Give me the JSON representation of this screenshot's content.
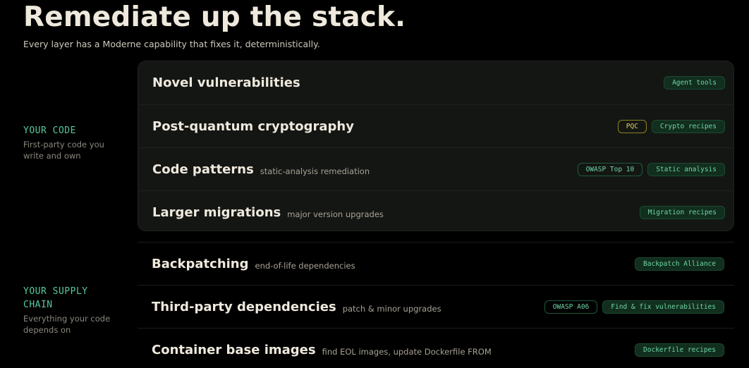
{
  "hero": {
    "title": "Remediate up the stack.",
    "subtitle": "Every layer has a Moderne capability that fixes it, deterministically."
  },
  "sections": [
    {
      "heading": "YOUR CODE",
      "description": "First-party code you write and own",
      "rows": [
        {
          "title": "Novel vulnerabilities",
          "subtitle": "",
          "tags": [
            {
              "label": "Agent tools",
              "style": "green"
            }
          ]
        },
        {
          "title": "Post-quantum cryptography",
          "subtitle": "",
          "tags": [
            {
              "label": "PQC",
              "style": "outline-yellow"
            },
            {
              "label": "Crypto recipes",
              "style": "green"
            }
          ]
        },
        {
          "title": "Code patterns",
          "subtitle": "static-analysis remediation",
          "tags": [
            {
              "label": "OWASP Top 10",
              "style": "outline-green"
            },
            {
              "label": "Static analysis",
              "style": "green"
            }
          ]
        },
        {
          "title": "Larger migrations",
          "subtitle": "major version upgrades",
          "tags": [
            {
              "label": "Migration recipes",
              "style": "green"
            }
          ]
        }
      ]
    },
    {
      "heading": "YOUR SUPPLY CHAIN",
      "description": "Everything your code depends on",
      "rows": [
        {
          "title": "Backpatching",
          "subtitle": "end-of-life dependencies",
          "tags": [
            {
              "label": "Backpatch Alliance",
              "style": "green"
            }
          ]
        },
        {
          "title": "Third-party dependencies",
          "subtitle": "patch & minor upgrades",
          "tags": [
            {
              "label": "OWASP A06",
              "style": "outline-green"
            },
            {
              "label": "Find & fix vulnerabilities",
              "style": "green"
            }
          ]
        },
        {
          "title": "Container base images",
          "subtitle": "find EOL images, update Dockerfile FROM",
          "tags": [
            {
              "label": "Dockerfile recipes",
              "style": "green"
            }
          ]
        }
      ]
    }
  ]
}
